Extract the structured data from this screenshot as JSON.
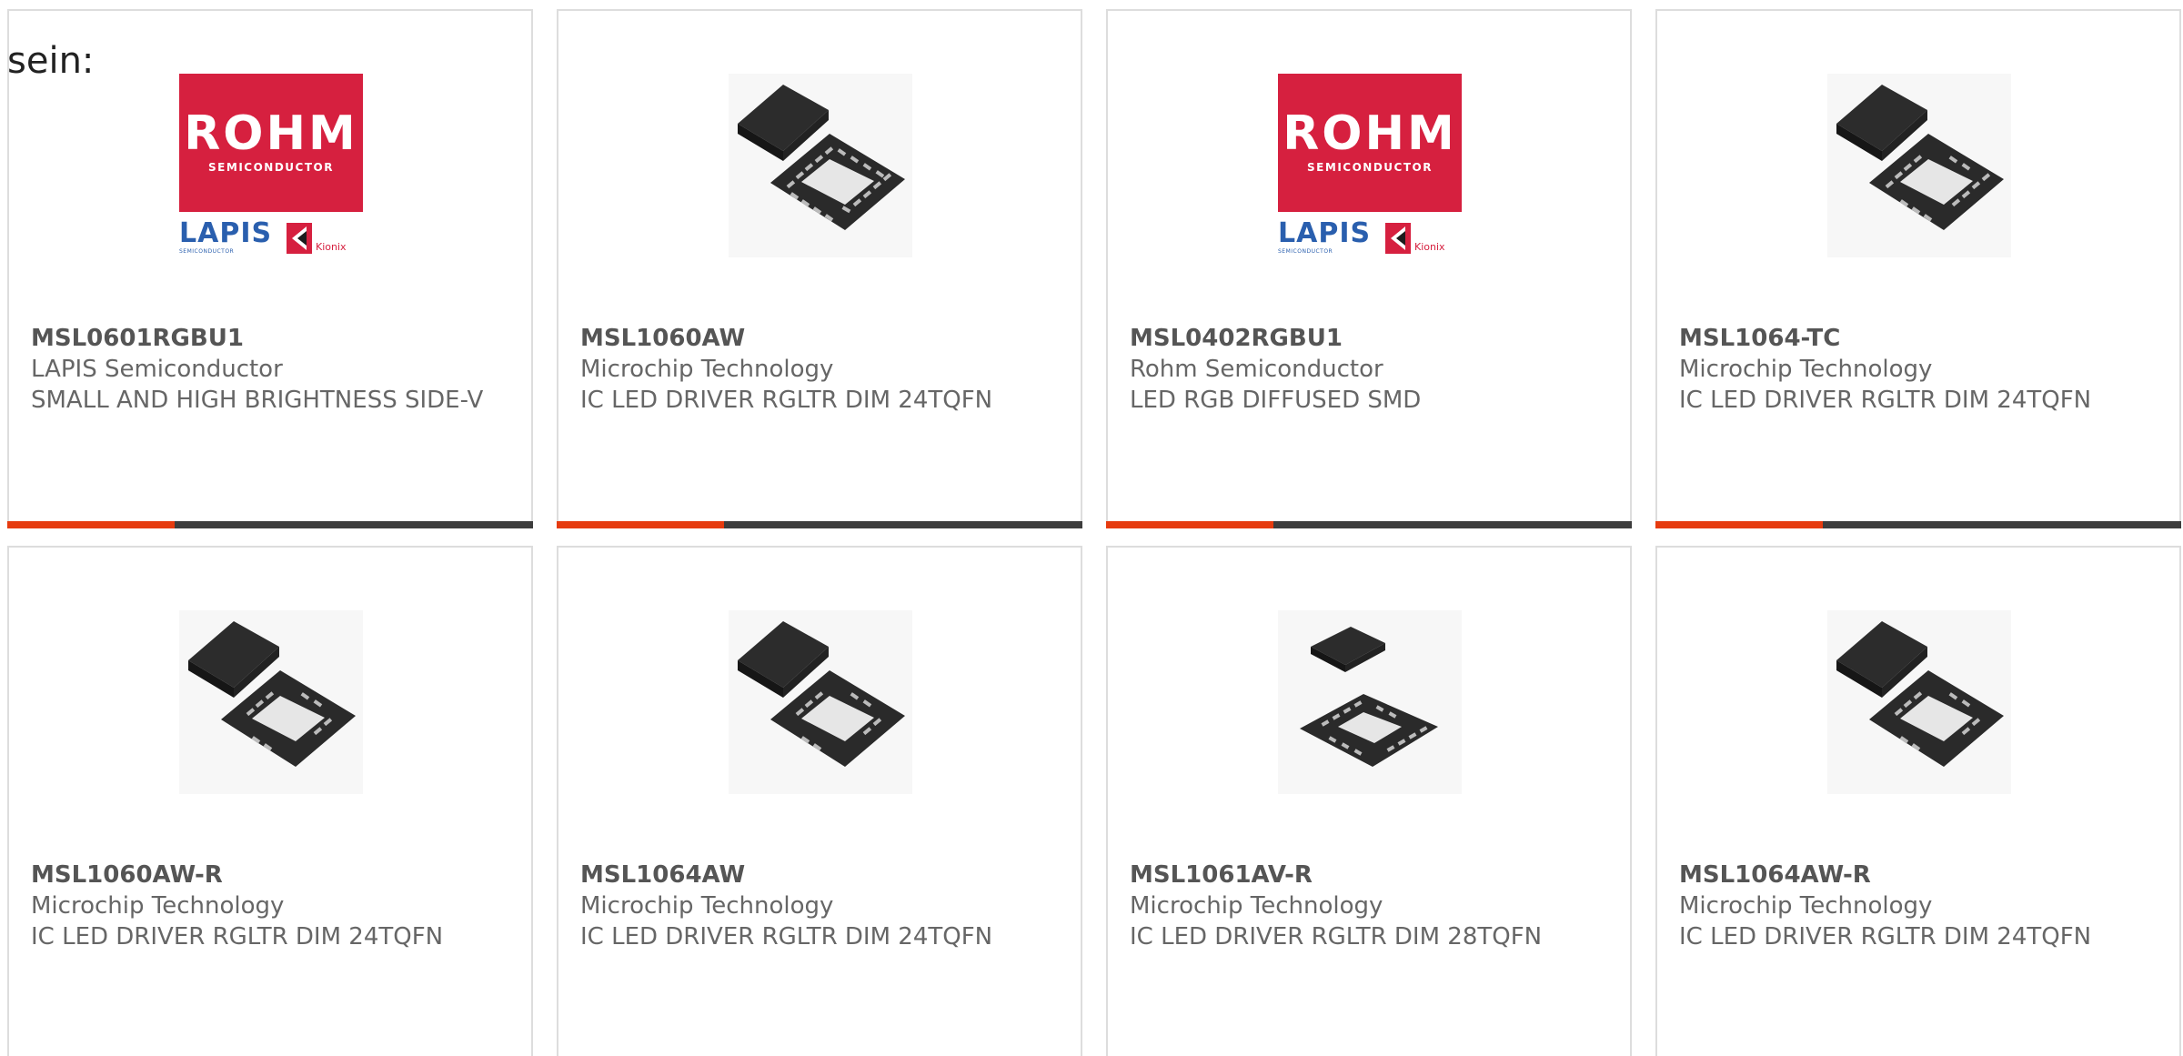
{
  "heading_fragment": "sein:",
  "colors": {
    "accent_bar": "#e63b0f",
    "dark_bar": "#3d3d3d",
    "card_border": "#dddddd",
    "text_gray": "#666666",
    "rohm_red": "#d6203f",
    "lapis_blue": "#2a5fae"
  },
  "logo": {
    "rohm": "ROHM",
    "rohm_sub": "SEMICONDUCTOR",
    "lapis": "LAPIS",
    "lapis_sub": "SEMICONDUCTOR",
    "kionix": "Kionix"
  },
  "products": [
    {
      "part": "MSL0601RGBU1",
      "manufacturer": "LAPIS Semiconductor",
      "description": "SMALL AND HIGH BRIGHTNESS SIDE-V",
      "image": "rohm-logo"
    },
    {
      "part": "MSL1060AW",
      "manufacturer": "Microchip Technology",
      "description": "IC LED DRIVER RGLTR DIM 24TQFN",
      "image": "qfn-chip-icon"
    },
    {
      "part": "MSL0402RGBU1",
      "manufacturer": "Rohm Semiconductor",
      "description": "LED RGB DIFFUSED SMD",
      "image": "rohm-logo"
    },
    {
      "part": "MSL1064-TC",
      "manufacturer": "Microchip Technology",
      "description": "IC LED DRIVER RGLTR DIM 24TQFN",
      "image": "qfn-chip-icon"
    },
    {
      "part": "MSL1060AW-R",
      "manufacturer": "Microchip Technology",
      "description": "IC LED DRIVER RGLTR DIM 24TQFN",
      "image": "qfn-chip-icon"
    },
    {
      "part": "MSL1064AW",
      "manufacturer": "Microchip Technology",
      "description": "IC LED DRIVER RGLTR DIM 24TQFN",
      "image": "qfn-chip-icon"
    },
    {
      "part": "MSL1061AV-R",
      "manufacturer": "Microchip Technology",
      "description": "IC LED DRIVER RGLTR DIM 28TQFN",
      "image": "qfn-chip-icon"
    },
    {
      "part": "MSL1064AW-R",
      "manufacturer": "Microchip Technology",
      "description": "IC LED DRIVER RGLTR DIM 24TQFN",
      "image": "qfn-chip-icon"
    }
  ]
}
